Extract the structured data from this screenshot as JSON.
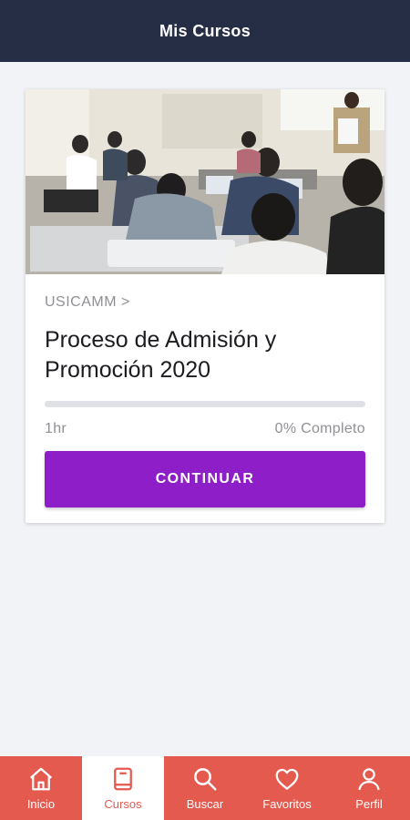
{
  "header": {
    "title": "Mis Cursos"
  },
  "course": {
    "breadcrumb": "USICAMM >",
    "title": "Proceso de Admisión y Promoción 2020",
    "duration": "1hr",
    "progress_fraction": 0.0,
    "progress_text": "0% Completo",
    "button_label": "CONTINUAR"
  },
  "nav": {
    "items": [
      {
        "label": "Inicio",
        "icon": "home-icon"
      },
      {
        "label": "Cursos",
        "icon": "book-icon",
        "active": true
      },
      {
        "label": "Buscar",
        "icon": "search-icon"
      },
      {
        "label": "Favoritos",
        "icon": "heart-icon"
      },
      {
        "label": "Perfil",
        "icon": "person-icon"
      }
    ]
  },
  "colors": {
    "header_bg": "#262e45",
    "accent_purple": "#8e1fc8",
    "nav_bg": "#e55a4f",
    "page_bg": "#f2f3f7"
  }
}
